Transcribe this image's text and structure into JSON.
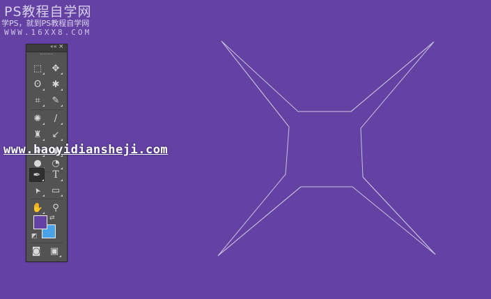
{
  "watermark": {
    "title": "PS教程自学网",
    "subtitle": "学PS，就到PS教程自学网",
    "site": "WWW.16XX8.COM",
    "url": "www.haoyidiansheji.com"
  },
  "toolbar": {
    "collapse_icon": "««",
    "close_icon": "×",
    "tools": [
      {
        "name": "marquee-tool-icon",
        "glyph": "⬚"
      },
      {
        "name": "move-tool-icon",
        "glyph": "✥"
      },
      {
        "name": "lasso-tool-icon",
        "glyph": "ʘ"
      },
      {
        "name": "magic-wand-tool-icon",
        "glyph": "✱"
      },
      {
        "name": "crop-tool-icon",
        "glyph": "⌗"
      },
      {
        "name": "eyedropper-tool-icon",
        "glyph": "✎"
      },
      {
        "name": "healing-brush-tool-icon",
        "glyph": "✺"
      },
      {
        "name": "brush-tool-icon",
        "glyph": "/"
      },
      {
        "name": "clone-stamp-tool-icon",
        "glyph": "♜"
      },
      {
        "name": "history-brush-tool-icon",
        "glyph": "↙"
      },
      {
        "name": "eraser-tool-icon",
        "glyph": "▰"
      },
      {
        "name": "gradient-tool-icon",
        "glyph": "◆"
      },
      {
        "name": "blur-tool-icon",
        "glyph": "●"
      },
      {
        "name": "dodge-tool-icon",
        "glyph": "◔"
      },
      {
        "name": "pen-tool-icon",
        "glyph": "✒"
      },
      {
        "name": "type-tool-icon",
        "glyph": "T"
      },
      {
        "name": "path-selection-tool-icon",
        "glyph": "➤"
      },
      {
        "name": "rectangle-tool-icon",
        "glyph": "▭"
      },
      {
        "name": "hand-tool-icon",
        "glyph": "✋"
      },
      {
        "name": "zoom-tool-icon",
        "glyph": "⚲"
      }
    ],
    "swap_colors_icon": "⇄",
    "default_colors_icon": "◩",
    "quick_mask_icon": "◙",
    "screen_mode_icon": "▣",
    "active_tool": "pen-tool-icon"
  },
  "colors": {
    "canvas": "#6342a4",
    "foreground": "#6342a4",
    "background": "#4aa3e8",
    "path_stroke": "#c9c0de"
  }
}
